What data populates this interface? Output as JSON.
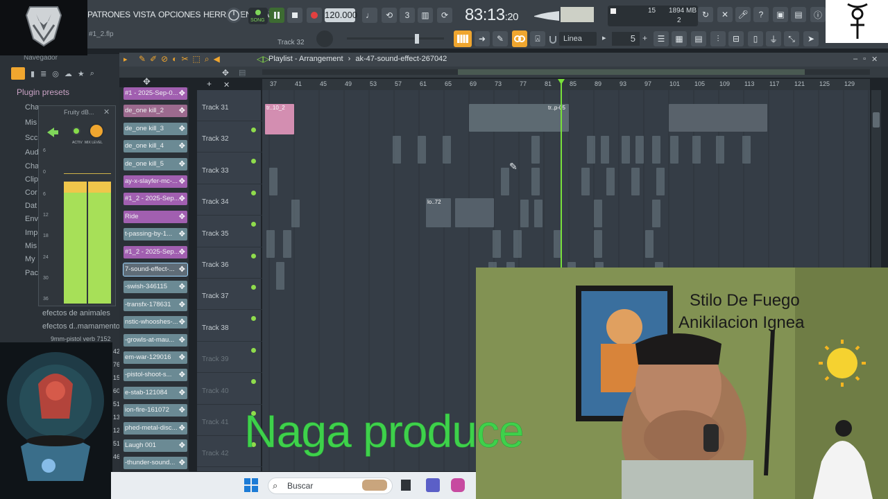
{
  "menu": [
    "PATRONES",
    "VISTA",
    "OPCIONES",
    "HERRAMIENTA",
    "AY"
  ],
  "topbar": {
    "song_label": "SONG",
    "tempo": "120.000",
    "time_main": "83:13",
    "time_sub": ":20",
    "cpu_value": "15",
    "mem_value": "1894 MB",
    "poly_value": "2",
    "project_file": "#1_2.flp",
    "track_hint": "Track 32",
    "snap_mode": "Linea",
    "step_value": "5"
  },
  "browser": {
    "title": "Navegador",
    "plugin_presets": "Plugin presets",
    "items": [
      "Cha",
      "Mis",
      "Scc",
      "Aud",
      "Cha",
      "Clip",
      "Cor",
      "Dat",
      "Env",
      "Imp",
      "Mis",
      "My",
      "Pac"
    ],
    "subitems": [
      "efectos de animales",
      "efectos d..mamamento",
      "9mm-pistol verb 7152"
    ]
  },
  "meter": {
    "title": "Fruity dB...",
    "active_label": "ACTIV",
    "level_label": "MIX LEVEL",
    "scale": [
      "6",
      "0",
      "6",
      "12",
      "18",
      "24",
      "30",
      "36"
    ],
    "side_numbers": [
      "42",
      "76",
      "15",
      "60",
      "51",
      "13",
      "12",
      "51",
      "46"
    ]
  },
  "playlist": {
    "title": "Playlist - Arrangement",
    "separator": "›",
    "clip_name": "ak-47-sound-effect-267042",
    "ruler": [
      "37",
      "41",
      "45",
      "49",
      "53",
      "57",
      "61",
      "65",
      "69",
      "73",
      "77",
      "81",
      "85",
      "89",
      "93",
      "97",
      "101",
      "105",
      "109",
      "113",
      "117",
      "121",
      "125",
      "129"
    ],
    "clips": [
      {
        "label": "#1 - 2025-Sep-0...",
        "color": "#a15fb0"
      },
      {
        "label": "de_one kill_2",
        "color": "#9c6a8e"
      },
      {
        "label": "de_one kill_3",
        "color": "#6b8a94"
      },
      {
        "label": "de_one kill_4",
        "color": "#6b8a94"
      },
      {
        "label": "de_one kill_5",
        "color": "#6b8a94"
      },
      {
        "label": "ay-x-slayfer-mc-...",
        "color": "#a15fb0"
      },
      {
        "label": "#1_2 - 2025-Sep...",
        "color": "#a15fb0"
      },
      {
        "label": "Ride",
        "color": "#a15fb0"
      },
      {
        "label": "t-passing-by-1...",
        "color": "#6b8a94"
      },
      {
        "label": "#1_2 - 2025-Sep...",
        "color": "#a15fb0"
      },
      {
        "label": "7-sound-effect-...",
        "color": "#5f6c77"
      },
      {
        "label": "-swish-346115",
        "color": "#6b8a94"
      },
      {
        "label": "-transfx-178631",
        "color": "#6b8a94"
      },
      {
        "label": "nstic-whooshes-...",
        "color": "#6b8a94"
      },
      {
        "label": "-growls-at-mau...",
        "color": "#6b8a94"
      },
      {
        "label": "em-war-129016",
        "color": "#6b8a94"
      },
      {
        "label": "-pistol-shoot-s...",
        "color": "#6b8a94"
      },
      {
        "label": "e-stab-121084",
        "color": "#6b8a94"
      },
      {
        "label": "ion-fire-161072",
        "color": "#6b8a94"
      },
      {
        "label": "phed-metal-disc...",
        "color": "#6b8a94"
      },
      {
        "label": "Laugh 001",
        "color": "#6b8a94"
      },
      {
        "label": "-thunder-sound...",
        "color": "#6b8a94"
      }
    ],
    "tracks": [
      "Track 31",
      "Track 32",
      "Track 33",
      "Track 34",
      "Track 35",
      "Track 36",
      "Track 37",
      "Track 38",
      "Track 39",
      "Track 40",
      "Track 41",
      "Track 42"
    ],
    "clip_labels": [
      "tr..10_2",
      "tr..p-05",
      "lo..72"
    ]
  },
  "webcam": {
    "title_line1": "Stilo De Fuego",
    "title_line2": "Anikilacion Ignea"
  },
  "overlay_title": "Naga produce",
  "taskbar": {
    "search_label": "Buscar"
  },
  "colors": {
    "accent_orange": "#f0a62f",
    "playhead_green": "#79e03b",
    "meter_green": "#a7e058",
    "title_green": "#3ed14b"
  }
}
